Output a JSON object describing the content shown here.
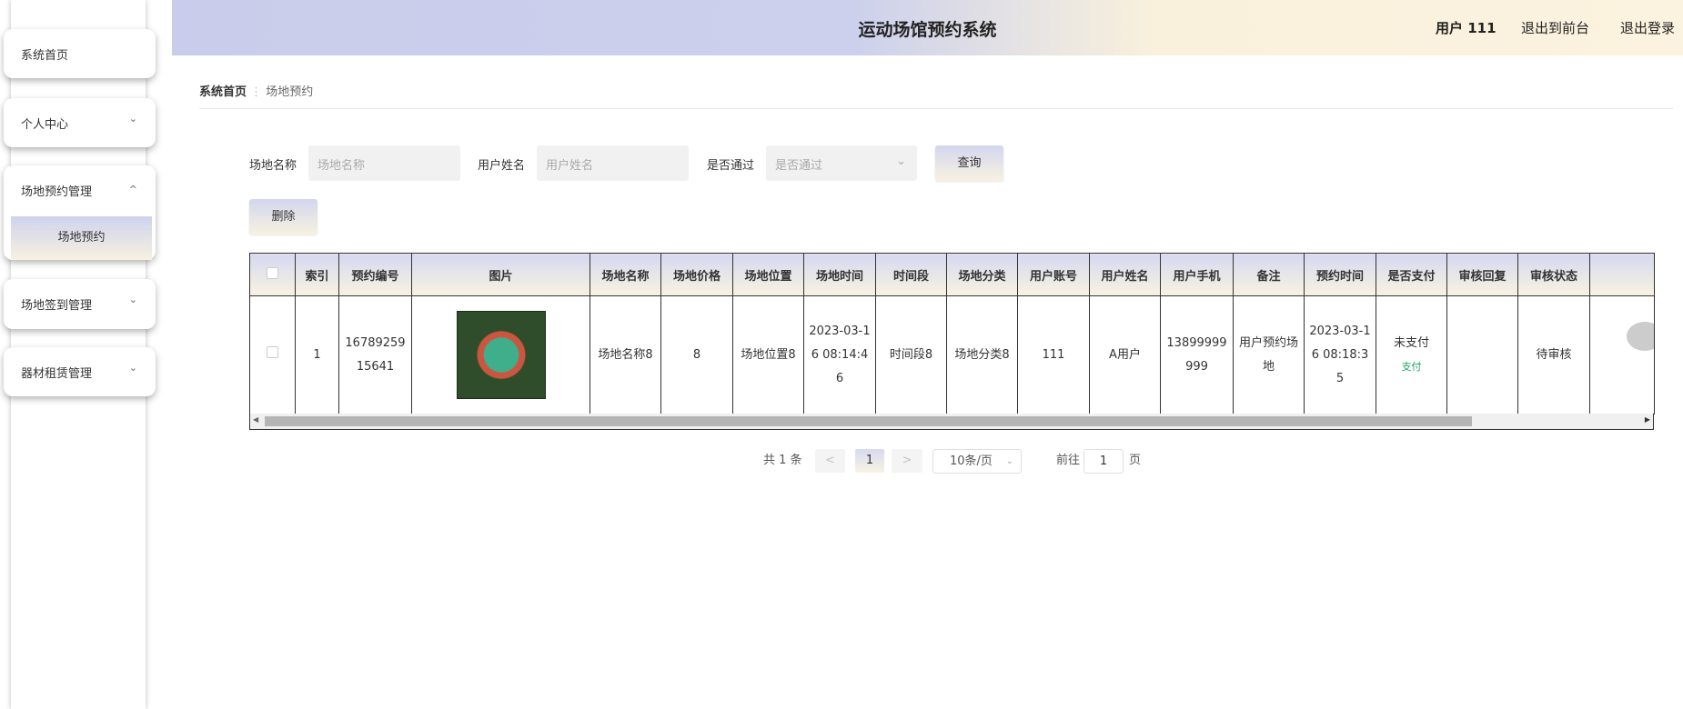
{
  "header": {
    "title": "运动场馆预约系统",
    "user": "用户 111",
    "to_front": "退出到前台",
    "logout": "退出登录"
  },
  "sidebar": {
    "items": [
      {
        "label": "系统首页"
      },
      {
        "label": "个人中心"
      },
      {
        "label": "场地预约管理",
        "sub": "场地预约"
      },
      {
        "label": "场地签到管理"
      },
      {
        "label": "器材租赁管理"
      }
    ]
  },
  "breadcrumb": {
    "home": "系统首页",
    "sep": "⋮",
    "current": "场地预约"
  },
  "search": {
    "name_label": "场地名称",
    "name_placeholder": "场地名称",
    "user_label": "用户姓名",
    "user_placeholder": "用户姓名",
    "pass_label": "是否通过",
    "pass_placeholder": "是否通过",
    "query": "查询",
    "delete": "删除"
  },
  "table": {
    "headers": [
      "索引",
      "预约编号",
      "图片",
      "场地名称",
      "场地价格",
      "场地位置",
      "场地时间",
      "时间段",
      "场地分类",
      "用户账号",
      "用户姓名",
      "用户手机",
      "备注",
      "预约时间",
      "是否支付",
      "审核回复",
      "审核状态"
    ],
    "row": {
      "index": "1",
      "no": "1678925915641",
      "name": "场地名称8",
      "price": "8",
      "location": "场地位置8",
      "time": "2023-03-16 08:14:46",
      "slot": "时间段8",
      "category": "场地分类8",
      "account": "111",
      "username": "A用户",
      "phone": "13899999999",
      "remark": "用户预约场地",
      "book_time": "2023-03-16 08:18:35",
      "paid": "未支付",
      "pay_link": "支付",
      "reply": "",
      "status": "待审核"
    }
  },
  "pagination": {
    "total": "共 1 条",
    "prev": "<",
    "page": "1",
    "next": ">",
    "size": "10条/页",
    "goto": "前往",
    "goto_value": "1",
    "page_suffix": "页"
  },
  "colors": {
    "pay": "#19a463"
  }
}
